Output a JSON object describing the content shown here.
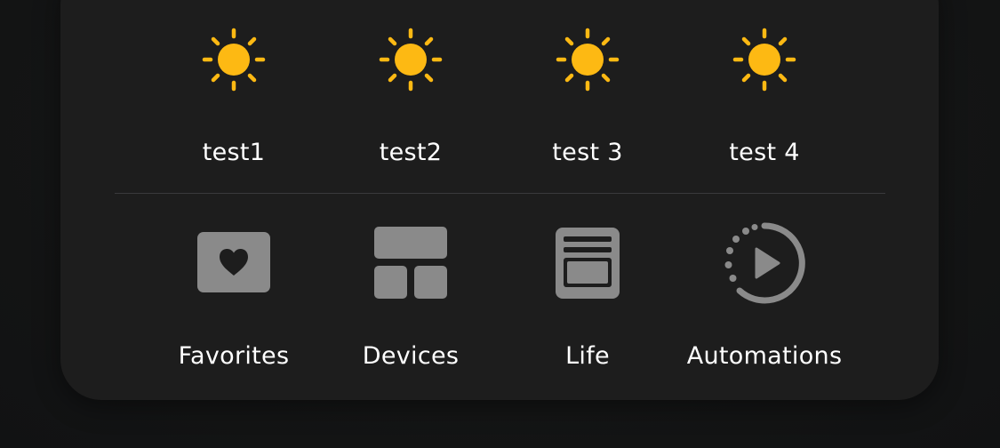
{
  "colors": {
    "panel": "#1d1d1d",
    "sun": "#FDB913",
    "tab_icon": "#8a8a8a",
    "text": "#ffffff"
  },
  "scenes": [
    {
      "label": "test1",
      "icon": "sun-icon"
    },
    {
      "label": "test2",
      "icon": "sun-icon"
    },
    {
      "label": "test 3",
      "icon": "sun-icon"
    },
    {
      "label": "test 4",
      "icon": "sun-icon"
    }
  ],
  "tabs": [
    {
      "label": "Favorites",
      "icon": "heart-card-icon"
    },
    {
      "label": "Devices",
      "icon": "devices-grid-icon"
    },
    {
      "label": "Life",
      "icon": "document-icon"
    },
    {
      "label": "Automations",
      "icon": "automation-play-icon"
    }
  ]
}
